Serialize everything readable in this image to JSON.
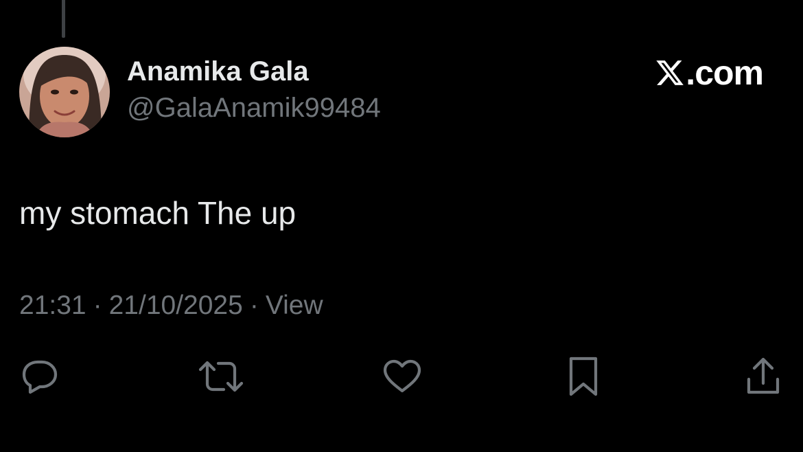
{
  "post": {
    "author": {
      "display_name": "Anamika Gala",
      "handle": "@GalaAnamik99484"
    },
    "brand": {
      "icon": "x-logo-icon",
      "text": ".com"
    },
    "text": "my stomach The up",
    "meta": {
      "time": "21:31",
      "separator": "·",
      "date": "21/10/2025",
      "view_label": "View"
    },
    "actions": [
      {
        "icon": "reply-icon"
      },
      {
        "icon": "repost-icon"
      },
      {
        "icon": "like-icon"
      },
      {
        "icon": "bookmark-icon"
      },
      {
        "icon": "share-icon"
      }
    ]
  },
  "colors": {
    "background": "#000000",
    "primary_text": "#e7e9ea",
    "secondary_text": "#71767b",
    "thread_line": "#3e4144"
  }
}
